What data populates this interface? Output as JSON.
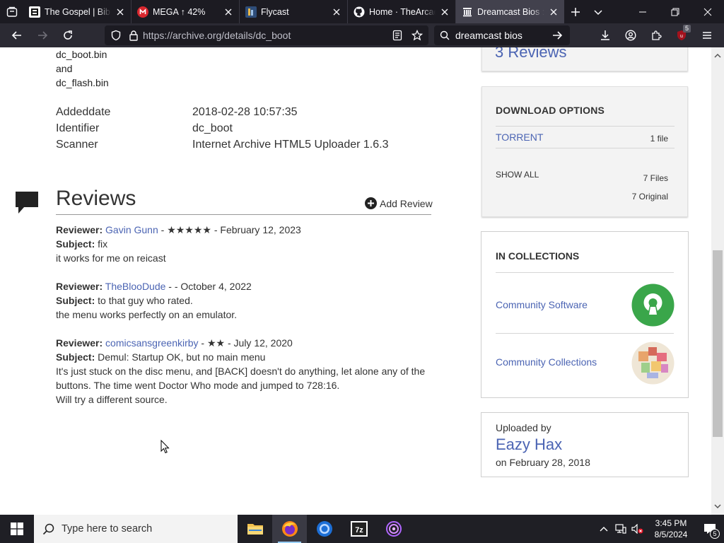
{
  "browser": {
    "tabs": [
      {
        "title": "The Gospel | BibleProject",
        "favicon": "bible-favicon",
        "active": false
      },
      {
        "title": "MEGA ↑ 42%",
        "favicon": "mega-favicon",
        "active": false
      },
      {
        "title": "Flycast",
        "favicon": "flycast-favicon",
        "active": false
      },
      {
        "title": "Home · TheArcadeStriker",
        "favicon": "github-icon",
        "active": false
      },
      {
        "title": "Dreamcast Bios : Free",
        "favicon": "archive-icon",
        "active": true
      }
    ],
    "url": "https://archive.org/details/dc_boot",
    "search_text": "dreamcast bios",
    "extension_badge": "5"
  },
  "page": {
    "file_lines": [
      "dc_boot.bin",
      "and",
      "dc_flash.bin"
    ],
    "metadata": [
      {
        "label": "Addeddate",
        "value": "2018-02-28 10:57:35"
      },
      {
        "label": "Identifier",
        "value": "dc_boot"
      },
      {
        "label": "Scanner",
        "value": "Internet Archive HTML5 Uploader 1.6.3"
      }
    ],
    "reviews": {
      "heading": "Reviews",
      "add_label": "Add Review",
      "count_label": "3 Reviews",
      "items": [
        {
          "reviewer_label": "Reviewer:",
          "reviewer": "Gavin Gunn",
          "meta": " - ★★★★★ - February 12, 2023",
          "subject_label": "Subject:",
          "subject": " fix",
          "body": "it works for me on reicast"
        },
        {
          "reviewer_label": "Reviewer:",
          "reviewer": "TheBlooDude",
          "meta": " - - October 4, 2022",
          "subject_label": "Subject:",
          "subject": " to that guy who rated.",
          "body": "the menu works perfectly on an emulator."
        },
        {
          "reviewer_label": "Reviewer:",
          "reviewer": "comicsansgreenkirby",
          "meta": " - ★★ - July 12, 2020",
          "subject_label": "Subject:",
          "subject": " Demul: Startup OK, but no main menu",
          "body": "It's just stuck on the disc menu, and [BACK] doesn't do anything, let alone any of the buttons. The time went Doctor Who mode and jumped to 728:16.",
          "body2": "Will try a different source."
        }
      ]
    },
    "downloads": {
      "title": "DOWNLOAD OPTIONS",
      "torrent_label": "TORRENT",
      "torrent_count": "1 file",
      "show_all_label": "SHOW ALL",
      "files_count": "7 Files",
      "original_count": "7 Original"
    },
    "collections": {
      "title": "IN COLLECTIONS",
      "items": [
        "Community Software",
        "Community Collections"
      ]
    },
    "uploader": {
      "label": "Uploaded by",
      "name": "Eazy Hax",
      "date": "on February 28, 2018"
    }
  },
  "taskbar": {
    "search_placeholder": "Type here to search",
    "time": "3:45 PM",
    "date": "8/5/2024",
    "notification_count": "5"
  },
  "colors": {
    "link": "#4b64b3",
    "tab_bg": "#1c1b22",
    "active_tab": "#42414d",
    "toolbar": "#2b2a33"
  }
}
